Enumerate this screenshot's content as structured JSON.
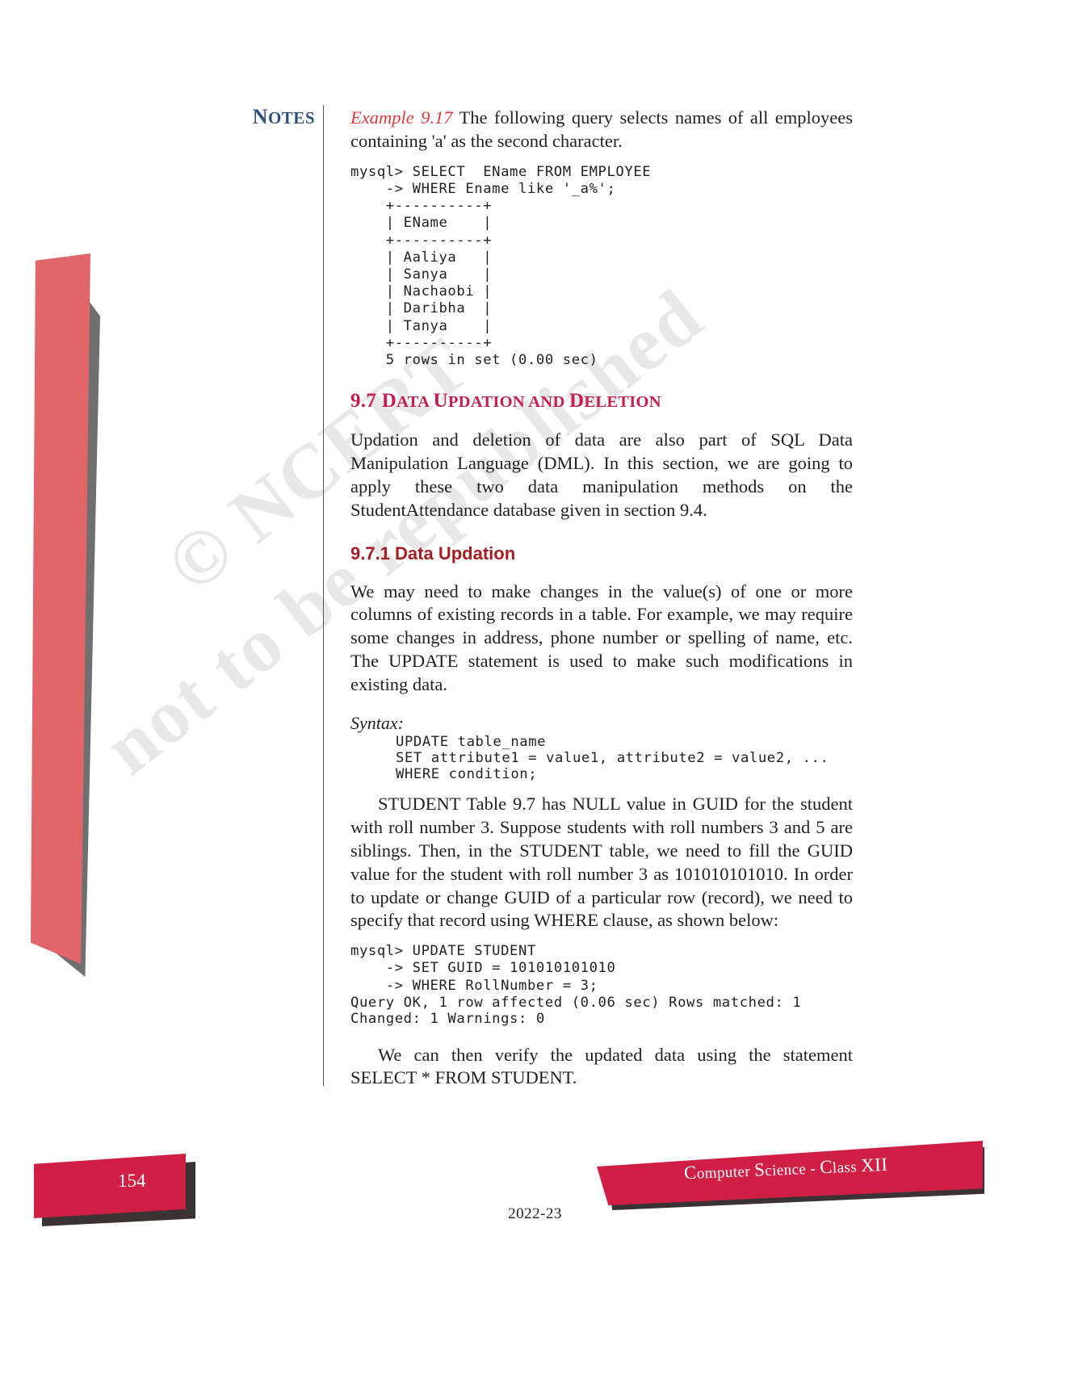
{
  "sidebar": {
    "notes_label_cap": "N",
    "notes_label_rest": "OTES"
  },
  "main": {
    "example": {
      "label": "Example 9.17",
      "text": "The following query selects names of all employees containing 'a' as the second character."
    },
    "query_block_1": "mysql> SELECT  EName FROM EMPLOYEE\n    -> WHERE Ename like '_a%';\n    +----------+\n    | EName    |\n    +----------+\n    | Aaliya   |\n    | Sanya    |\n    | Nachaobi |\n    | Daribha  |\n    | Tanya    |\n    +----------+\n    5 rows in set (0.00 sec)",
    "section_heading": {
      "number": "9.7 ",
      "word1_cap": "D",
      "word1_rest": "ata ",
      "word2_cap": "U",
      "word2_rest": "pdation ",
      "word3_rest": "and ",
      "word4_cap": "D",
      "word4_rest": "eletion"
    },
    "section_paragraph": "Updation and deletion of data are also part of SQL Data Manipulation Language (DML). In this section, we are going to apply these two data manipulation methods on the StudentAttendance database given in section 9.4.",
    "subsection_heading": "9.7.1 Data Updation",
    "subsection_paragraph": "We may need to make changes in the value(s) of one or more columns of existing records in a table. For example, we may require some changes in address, phone number or spelling of name, etc. The UPDATE statement is used to make such modifications in existing data.",
    "syntax_label": "Syntax:",
    "syntax_block": "UPDATE table_name\nSET attribute1 = value1, attribute2 = value2, ...\nWHERE condition;",
    "student_paragraph": "STUDENT Table 9.7 has NULL value in GUID for the student with roll number 3. Suppose students with roll numbers 3 and 5 are siblings. Then, in the STUDENT table, we need to fill the GUID value for the student with roll number 3 as 101010101010. In order to update or change GUID of a particular row (record), we need to specify that record using WHERE clause, as shown below:",
    "query_block_2": "mysql> UPDATE STUDENT\n    -> SET GUID = 101010101010\n    -> WHERE RollNumber = 3;",
    "query_output_2": "Query OK, 1 row affected (0.06 sec) Rows matched: 1\nChanged: 1 Warnings: 0",
    "closing_paragraph": "We can then verify the updated data using the statement SELECT * FROM STUDENT."
  },
  "watermark": {
    "line1": "© NCERT",
    "line2": "not to be republished"
  },
  "footer": {
    "page_number": "154",
    "year": "2022-23",
    "book_title_parts": {
      "c1": "C",
      "w1": "omputer ",
      "c2": "S",
      "w2": "cience",
      "dash": " - ",
      "c3": "C",
      "w3": "lass ",
      "cls": "XII"
    }
  },
  "colors": {
    "accent_crimson": "#c51f45",
    "heading_red": "#c51f4f",
    "subheading_red": "#a41d22",
    "example_red": "#e03a3e",
    "notes_blue": "#2f4f7f",
    "bar_red": "#e2656a",
    "bar_gray": "#6f6f6f"
  }
}
